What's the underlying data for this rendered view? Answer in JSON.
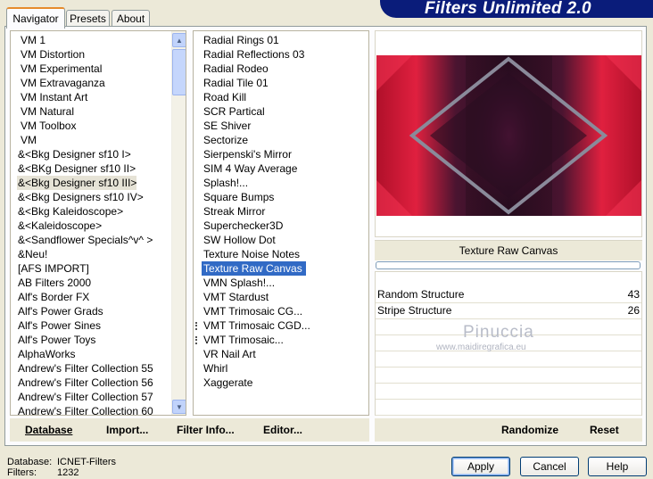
{
  "tabs": [
    "Navigator",
    "Presets",
    "About"
  ],
  "banner_title": "Filters Unlimited 2.0",
  "categories": [
    "VM 1",
    "VM Distortion",
    "VM Experimental",
    "VM Extravaganza",
    "VM Instant Art",
    "VM Natural",
    "VM Toolbox",
    "VM",
    "&<Bkg Designer sf10 I>",
    "&<BKg Designer sf10 II>",
    "&<Bkg Designer sf10 III>",
    "&<Bkg Designers sf10 IV>",
    "&<Bkg Kaleidoscope>",
    "&<Kaleidoscope>",
    "&<Sandflower Specials^v^ >",
    "&Neu!",
    "[AFS IMPORT]",
    "AB Filters 2000",
    "Alf's Border FX",
    "Alf's Power Grads",
    "Alf's Power Sines",
    "Alf's Power Toys",
    "AlphaWorks",
    "Andrew's Filter Collection 55",
    "Andrew's Filter Collection 56",
    "Andrew's Filter Collection 57",
    "Andrew's Filter Collection 60"
  ],
  "filters": [
    "Radial  Rings 01",
    "Radial Reflections 03",
    "Radial Rodeo",
    "Radial Tile 01",
    "Road Kill",
    "SCR  Partical",
    "SE Shiver",
    "Sectorize",
    "Sierpenski's Mirror",
    "SIM 4 Way Average",
    "Splash!...",
    "Square Bumps",
    "Streak Mirror",
    "Superchecker3D",
    "SW Hollow Dot",
    "Texture Noise Notes",
    "Texture Raw Canvas",
    "VMN Splash!...",
    "VMT Stardust",
    "VMT Trimosaic CG...",
    "VMT Trimosaic CGD...",
    "VMT Trimosaic...",
    "VR Nail Art",
    "Whirl",
    "Xaggerate"
  ],
  "selected_filter_name": "Texture Raw Canvas",
  "params": [
    {
      "label": "Random Structure",
      "value": "43"
    },
    {
      "label": "Stripe Structure",
      "value": "26"
    }
  ],
  "watermark": {
    "name": "Pinuccia",
    "url": "www.maidiregrafica.eu"
  },
  "left_buttons": {
    "database": "Database",
    "import": "Import...",
    "filter_info": "Filter Info...",
    "editor": "Editor..."
  },
  "right_buttons": {
    "randomize": "Randomize",
    "reset": "Reset"
  },
  "status": {
    "database_label": "Database:",
    "database_value": "ICNET-Filters",
    "filters_label": "Filters:",
    "filters_value": "1232"
  },
  "dialog_buttons": {
    "apply": "Apply",
    "cancel": "Cancel",
    "help": "Help"
  }
}
